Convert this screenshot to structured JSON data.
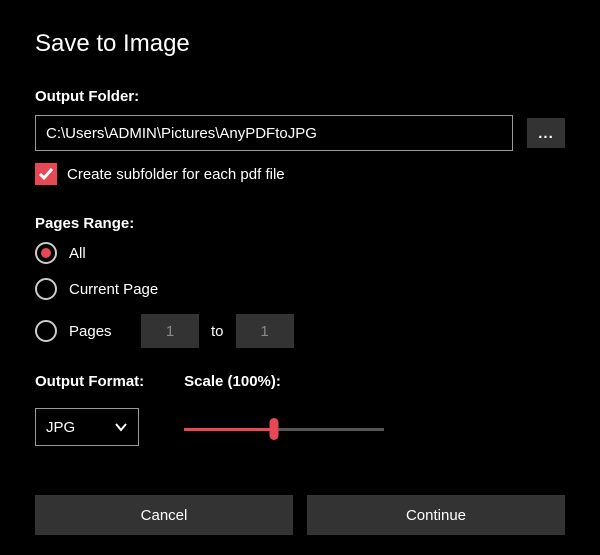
{
  "title": "Save to Image",
  "output_folder": {
    "label": "Output Folder:",
    "value": "C:\\Users\\ADMIN\\Pictures\\AnyPDFtoJPG",
    "browse_label": "..."
  },
  "subfolder": {
    "checked": true,
    "label": "Create subfolder for each pdf file"
  },
  "pages_range": {
    "label": "Pages Range:",
    "options": {
      "all": "All",
      "current": "Current Page",
      "pages": "Pages"
    },
    "selected": "all",
    "from": "1",
    "to_label": "to",
    "to": "1"
  },
  "output_format": {
    "label": "Output Format:",
    "value": "JPG"
  },
  "scale": {
    "label": "Scale (100%):",
    "percent": 100
  },
  "actions": {
    "cancel": "Cancel",
    "continue": "Continue"
  },
  "colors": {
    "accent": "#e84855"
  }
}
